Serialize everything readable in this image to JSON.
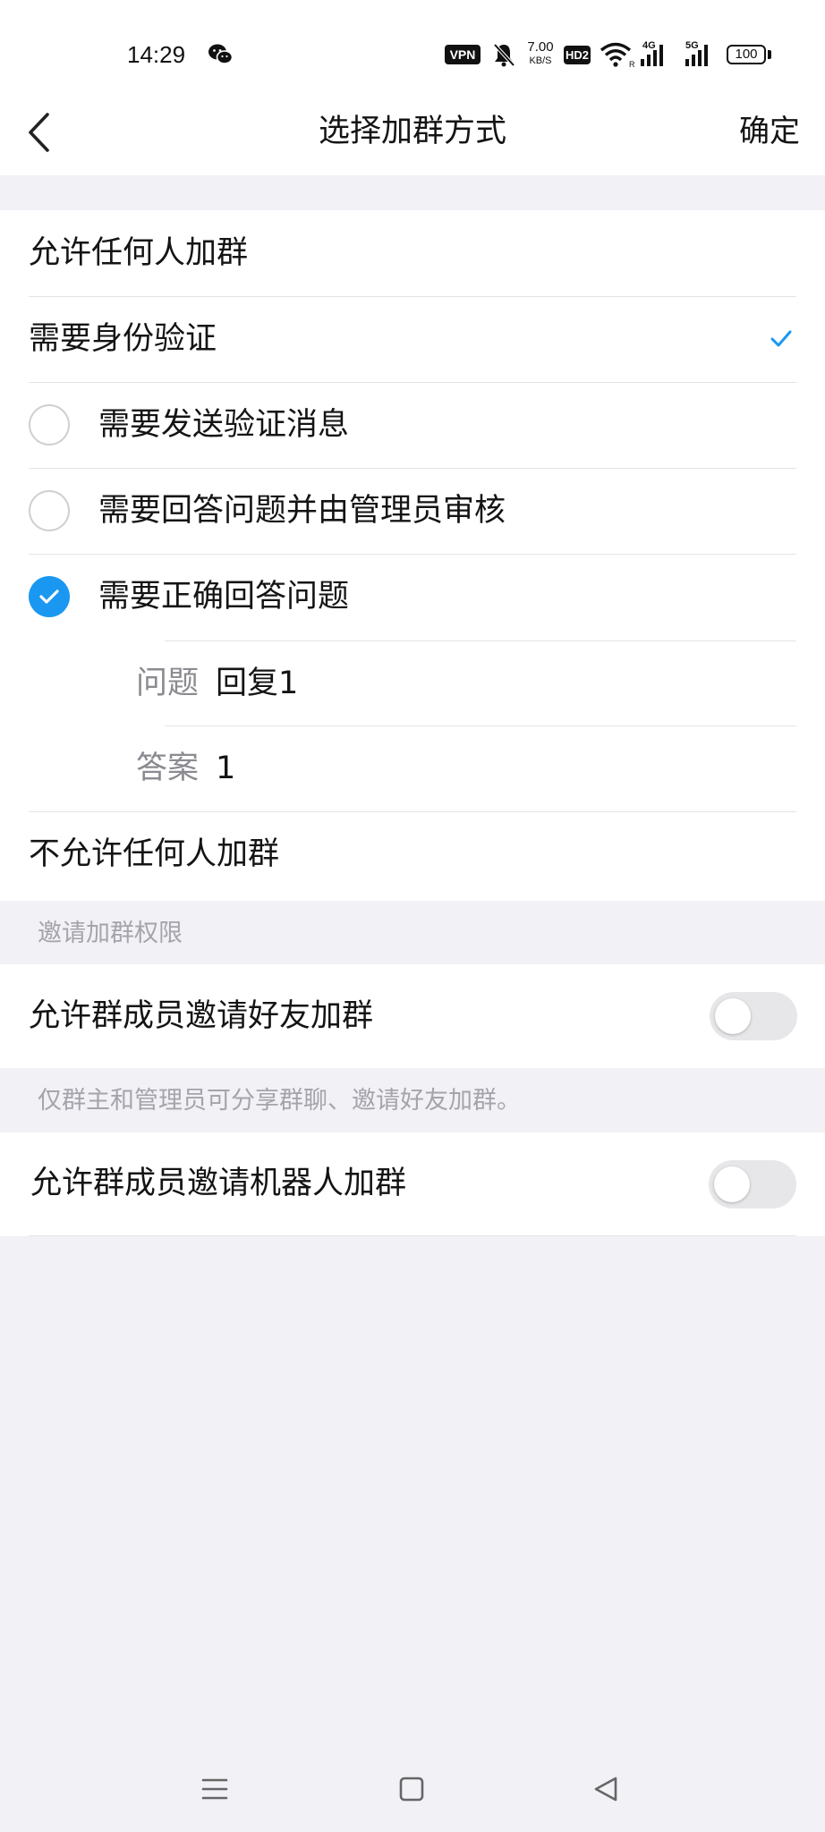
{
  "status_bar": {
    "time": "14:29",
    "vpn": "VPN",
    "net_speed_value": "7.00",
    "net_speed_unit": "KB/S",
    "hd": "HD2",
    "battery": "100",
    "icons": [
      "wechat-icon",
      "bell-muted-icon",
      "wifi-icon",
      "signal-4g-icon",
      "signal-5g-icon"
    ]
  },
  "header": {
    "title": "选择加群方式",
    "confirm_label": "确定",
    "back_icon": "chevron-left-icon"
  },
  "join_options": {
    "allow_anyone": "允许任何人加群",
    "require_verification": "需要身份验证",
    "sub_options": [
      {
        "label": "需要发送验证消息",
        "checked": false
      },
      {
        "label": "需要回答问题并由管理员审核",
        "checked": false
      },
      {
        "label": "需要正确回答问题",
        "checked": true
      }
    ],
    "question_key": "问题",
    "question_value": "回复1",
    "answer_key": "答案",
    "answer_value": "1",
    "disallow_anyone": "不允许任何人加群"
  },
  "invite": {
    "caption": "邀请加群权限",
    "allow_member_invite_friends": "允许群成员邀请好友加群",
    "allow_member_invite_friends_on": false,
    "note": "仅群主和管理员可分享群聊、邀请好友加群。",
    "allow_member_invite_bots": "允许群成员邀请机器人加群",
    "allow_member_invite_bots_on": false
  },
  "colors": {
    "accent": "#1a97f0",
    "background": "#f1f1f6",
    "card": "#ffffff",
    "secondary_text": "#8a8a90",
    "caption_text": "#a4a4ab"
  },
  "nav_bar": {
    "icons": [
      "menu-icon",
      "home-square-icon",
      "back-triangle-icon"
    ]
  }
}
